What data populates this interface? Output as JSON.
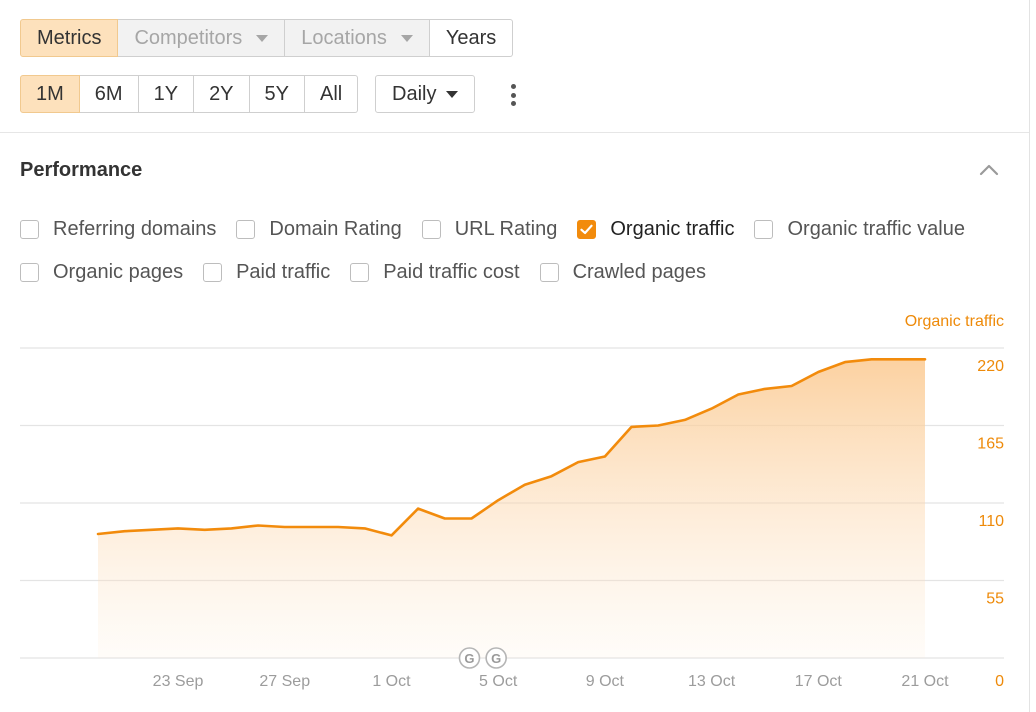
{
  "toolbar": {
    "tabs": [
      {
        "label": "Metrics",
        "state": "active"
      },
      {
        "label": "Competitors",
        "state": "disabled"
      },
      {
        "label": "Locations",
        "state": "disabled"
      },
      {
        "label": "Years",
        "state": "normal"
      }
    ],
    "ranges": [
      {
        "label": "1M",
        "active": true
      },
      {
        "label": "6M",
        "active": false
      },
      {
        "label": "1Y",
        "active": false
      },
      {
        "label": "2Y",
        "active": false
      },
      {
        "label": "5Y",
        "active": false
      },
      {
        "label": "All",
        "active": false
      }
    ],
    "granularity": "Daily"
  },
  "panel": {
    "title": "Performance",
    "metrics_row1": [
      {
        "label": "Referring domains",
        "checked": false
      },
      {
        "label": "Domain Rating",
        "checked": false
      },
      {
        "label": "URL Rating",
        "checked": false
      },
      {
        "label": "Organic traffic",
        "checked": true
      },
      {
        "label": "Organic traffic value",
        "checked": false
      }
    ],
    "metrics_row2": [
      {
        "label": "Organic pages",
        "checked": false
      },
      {
        "label": "Paid traffic",
        "checked": false
      },
      {
        "label": "Paid traffic cost",
        "checked": false
      },
      {
        "label": "Crawled pages",
        "checked": false
      }
    ]
  },
  "colors": {
    "accent": "#f28b0c",
    "axis_text": "#ee8a09",
    "active_bg": "#fde1bc"
  },
  "chart_data": {
    "type": "area",
    "series": [
      {
        "name": "Organic traffic",
        "x": [
          "20 Sep",
          "21 Sep",
          "22 Sep",
          "23 Sep",
          "24 Sep",
          "25 Sep",
          "26 Sep",
          "27 Sep",
          "28 Sep",
          "29 Sep",
          "30 Sep",
          "1 Oct",
          "2 Oct",
          "3 Oct",
          "4 Oct",
          "5 Oct",
          "6 Oct",
          "7 Oct",
          "8 Oct",
          "9 Oct",
          "10 Oct",
          "11 Oct",
          "12 Oct",
          "13 Oct",
          "14 Oct",
          "15 Oct",
          "16 Oct",
          "17 Oct",
          "18 Oct",
          "19 Oct",
          "20 Oct",
          "21 Oct"
        ],
        "values": [
          88,
          90,
          91,
          92,
          91,
          92,
          94,
          93,
          93,
          93,
          92,
          87,
          106,
          99,
          99,
          112,
          123,
          129,
          139,
          143,
          164,
          165,
          169,
          177,
          187,
          191,
          193,
          203,
          210,
          212,
          212,
          212
        ]
      }
    ],
    "x_tick_labels": [
      "23 Sep",
      "27 Sep",
      "1 Oct",
      "5 Oct",
      "9 Oct",
      "13 Oct",
      "17 Oct",
      "21 Oct"
    ],
    "y_ticks": [
      0,
      55,
      110,
      165,
      220
    ],
    "ylim": [
      0,
      220
    ],
    "annotations": [
      "G",
      "G"
    ],
    "annotation_x": [
      "4 Oct",
      "5 Oct"
    ],
    "grid": true,
    "y_axis_side": "right"
  }
}
